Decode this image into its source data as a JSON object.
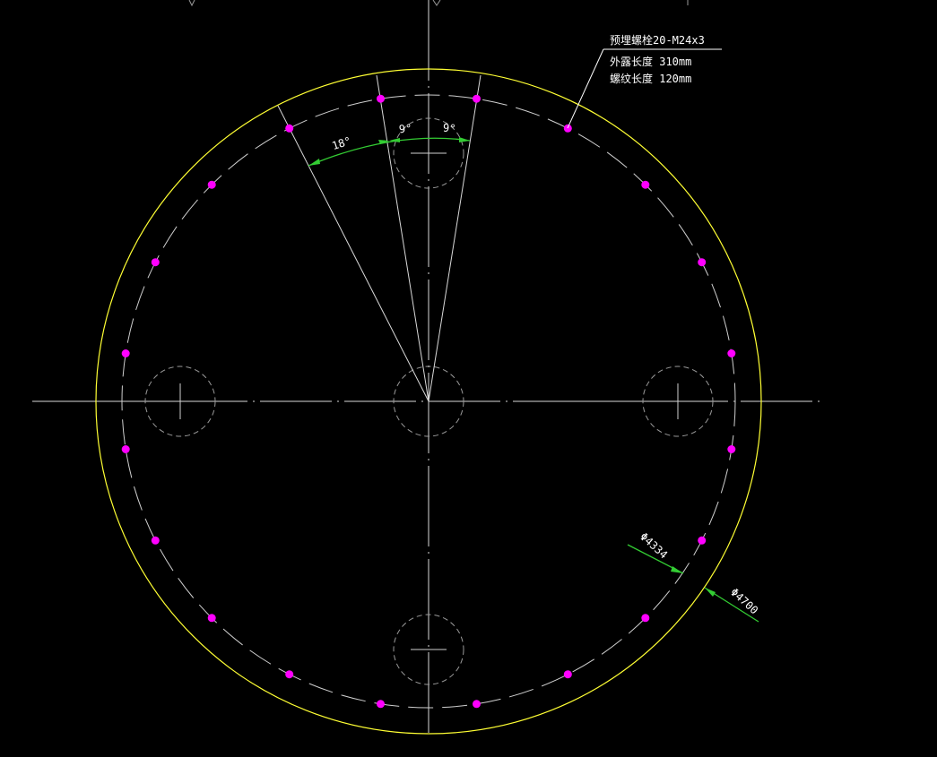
{
  "colors": {
    "background": "#000000",
    "centerline": "#d9d9d9",
    "outer_circle": "#ffff33",
    "bolt_circle": "#cfcfcf",
    "bolt": "#ff00ff",
    "dimension": "#33cc33",
    "text": "#ffffff",
    "hole": "#9a9a9a"
  },
  "bolt_callout": {
    "title": "预埋螺栓20-M24x3",
    "exposed_length": "外露长度 310mm",
    "thread_length": "螺纹长度 120mm"
  },
  "angle_dims": {
    "angle_18": "18°",
    "angle_9_left": "9°",
    "angle_9_right": "9°"
  },
  "diameter_dims": {
    "bolt_circle": "Φ4334",
    "outer": "Φ4700"
  },
  "bolts": {
    "count": 20,
    "spacing_deg": 18,
    "offset_deg": 9
  },
  "icons": {
    "bolt_marker": "bolt-dot-icon",
    "hole_marker": "hole-circle-icon"
  }
}
